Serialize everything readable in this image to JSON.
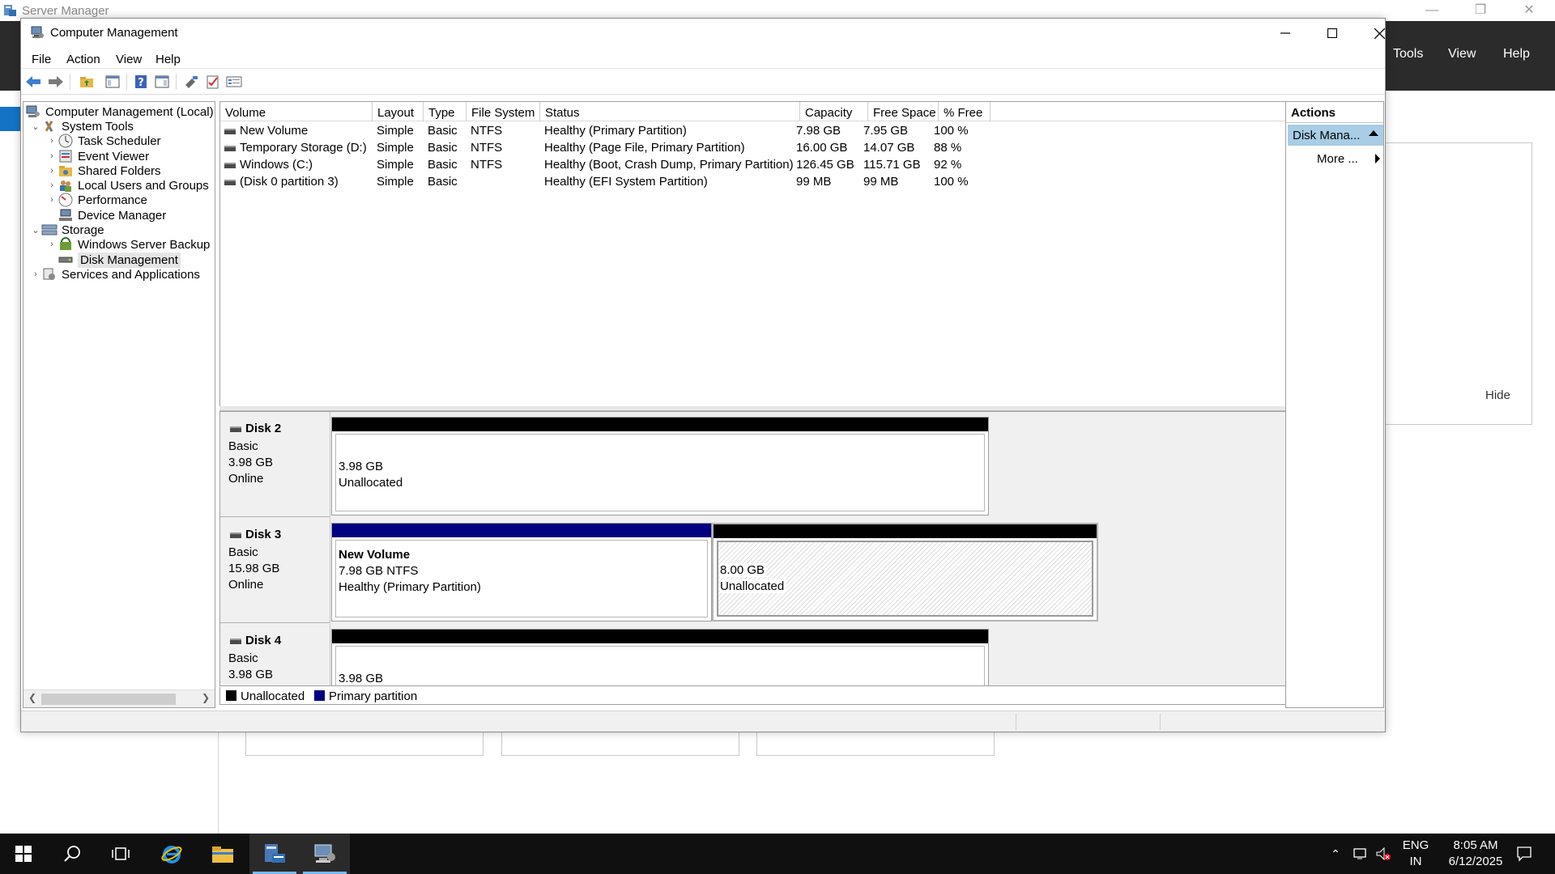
{
  "background": {
    "app_title": "Server Manager",
    "menu": [
      "Tools",
      "View",
      "Help"
    ],
    "hide_label": "Hide"
  },
  "window": {
    "title": "Computer Management",
    "menu": [
      "File",
      "Action",
      "View",
      "Help"
    ]
  },
  "tree": [
    {
      "label": "Computer Management (Local)",
      "icon": "computer-management-icon"
    },
    {
      "label": "System Tools",
      "icon": "tools-icon",
      "expanded": true
    },
    {
      "label": "Task Scheduler",
      "icon": "clock-icon"
    },
    {
      "label": "Event Viewer",
      "icon": "event-viewer-icon"
    },
    {
      "label": "Shared Folders",
      "icon": "shared-folder-icon"
    },
    {
      "label": "Local Users and Groups",
      "icon": "users-icon"
    },
    {
      "label": "Performance",
      "icon": "performance-icon"
    },
    {
      "label": "Device Manager",
      "icon": "device-manager-icon"
    },
    {
      "label": "Storage",
      "icon": "storage-icon",
      "expanded": true
    },
    {
      "label": "Windows Server Backup",
      "icon": "backup-icon"
    },
    {
      "label": "Disk Management",
      "icon": "disk-management-icon",
      "selected": true
    },
    {
      "label": "Services and Applications",
      "icon": "services-icon"
    }
  ],
  "volumes": {
    "columns": [
      "Volume",
      "Layout",
      "Type",
      "File System",
      "Status",
      "Capacity",
      "Free Space",
      "% Free"
    ],
    "rows": [
      [
        "New Volume",
        "Simple",
        "Basic",
        "NTFS",
        "Healthy (Primary Partition)",
        "7.98 GB",
        "7.95 GB",
        "100 %"
      ],
      [
        "Temporary Storage (D:)",
        "Simple",
        "Basic",
        "NTFS",
        "Healthy (Page File, Primary Partition)",
        "16.00 GB",
        "14.07 GB",
        "88 %"
      ],
      [
        "Windows (C:)",
        "Simple",
        "Basic",
        "NTFS",
        "Healthy (Boot, Crash Dump, Primary Partition)",
        "126.45 GB",
        "115.71 GB",
        "92 %"
      ],
      [
        "(Disk 0 partition 3)",
        "Simple",
        "Basic",
        "",
        "Healthy (EFI System Partition)",
        "99 MB",
        "99 MB",
        "100 %"
      ]
    ]
  },
  "disks": [
    {
      "name": "Disk 2",
      "type": "Basic",
      "size": "3.98 GB",
      "state": "Online",
      "partitions": [
        {
          "size": "3.98 GB",
          "label": "Unallocated"
        }
      ]
    },
    {
      "name": "Disk 3",
      "type": "Basic",
      "size": "15.98 GB",
      "state": "Online",
      "partitions": [
        {
          "title": "New Volume",
          "size": "7.98 GB NTFS",
          "label": "Healthy (Primary Partition)"
        },
        {
          "size": "8.00 GB",
          "label": "Unallocated"
        }
      ]
    },
    {
      "name": "Disk 4",
      "type": "Basic",
      "size": "3.98 GB",
      "partitions": [
        {
          "size": "3.98 GB"
        }
      ]
    }
  ],
  "legend": [
    {
      "label": "Unallocated",
      "color": "#000000"
    },
    {
      "label": "Primary partition",
      "color": "#000080"
    }
  ],
  "actions": {
    "header": "Actions",
    "selected": "Disk Mana...",
    "more": "More ..."
  },
  "taskbar": {
    "lang": "ENG",
    "region": "IN",
    "time": "8:05 AM",
    "date": "6/12/2025"
  },
  "colors": {
    "primary_partition": "#000080",
    "unallocated": "#000000",
    "selection": "#a8cde5",
    "taskbar": "#101010"
  }
}
